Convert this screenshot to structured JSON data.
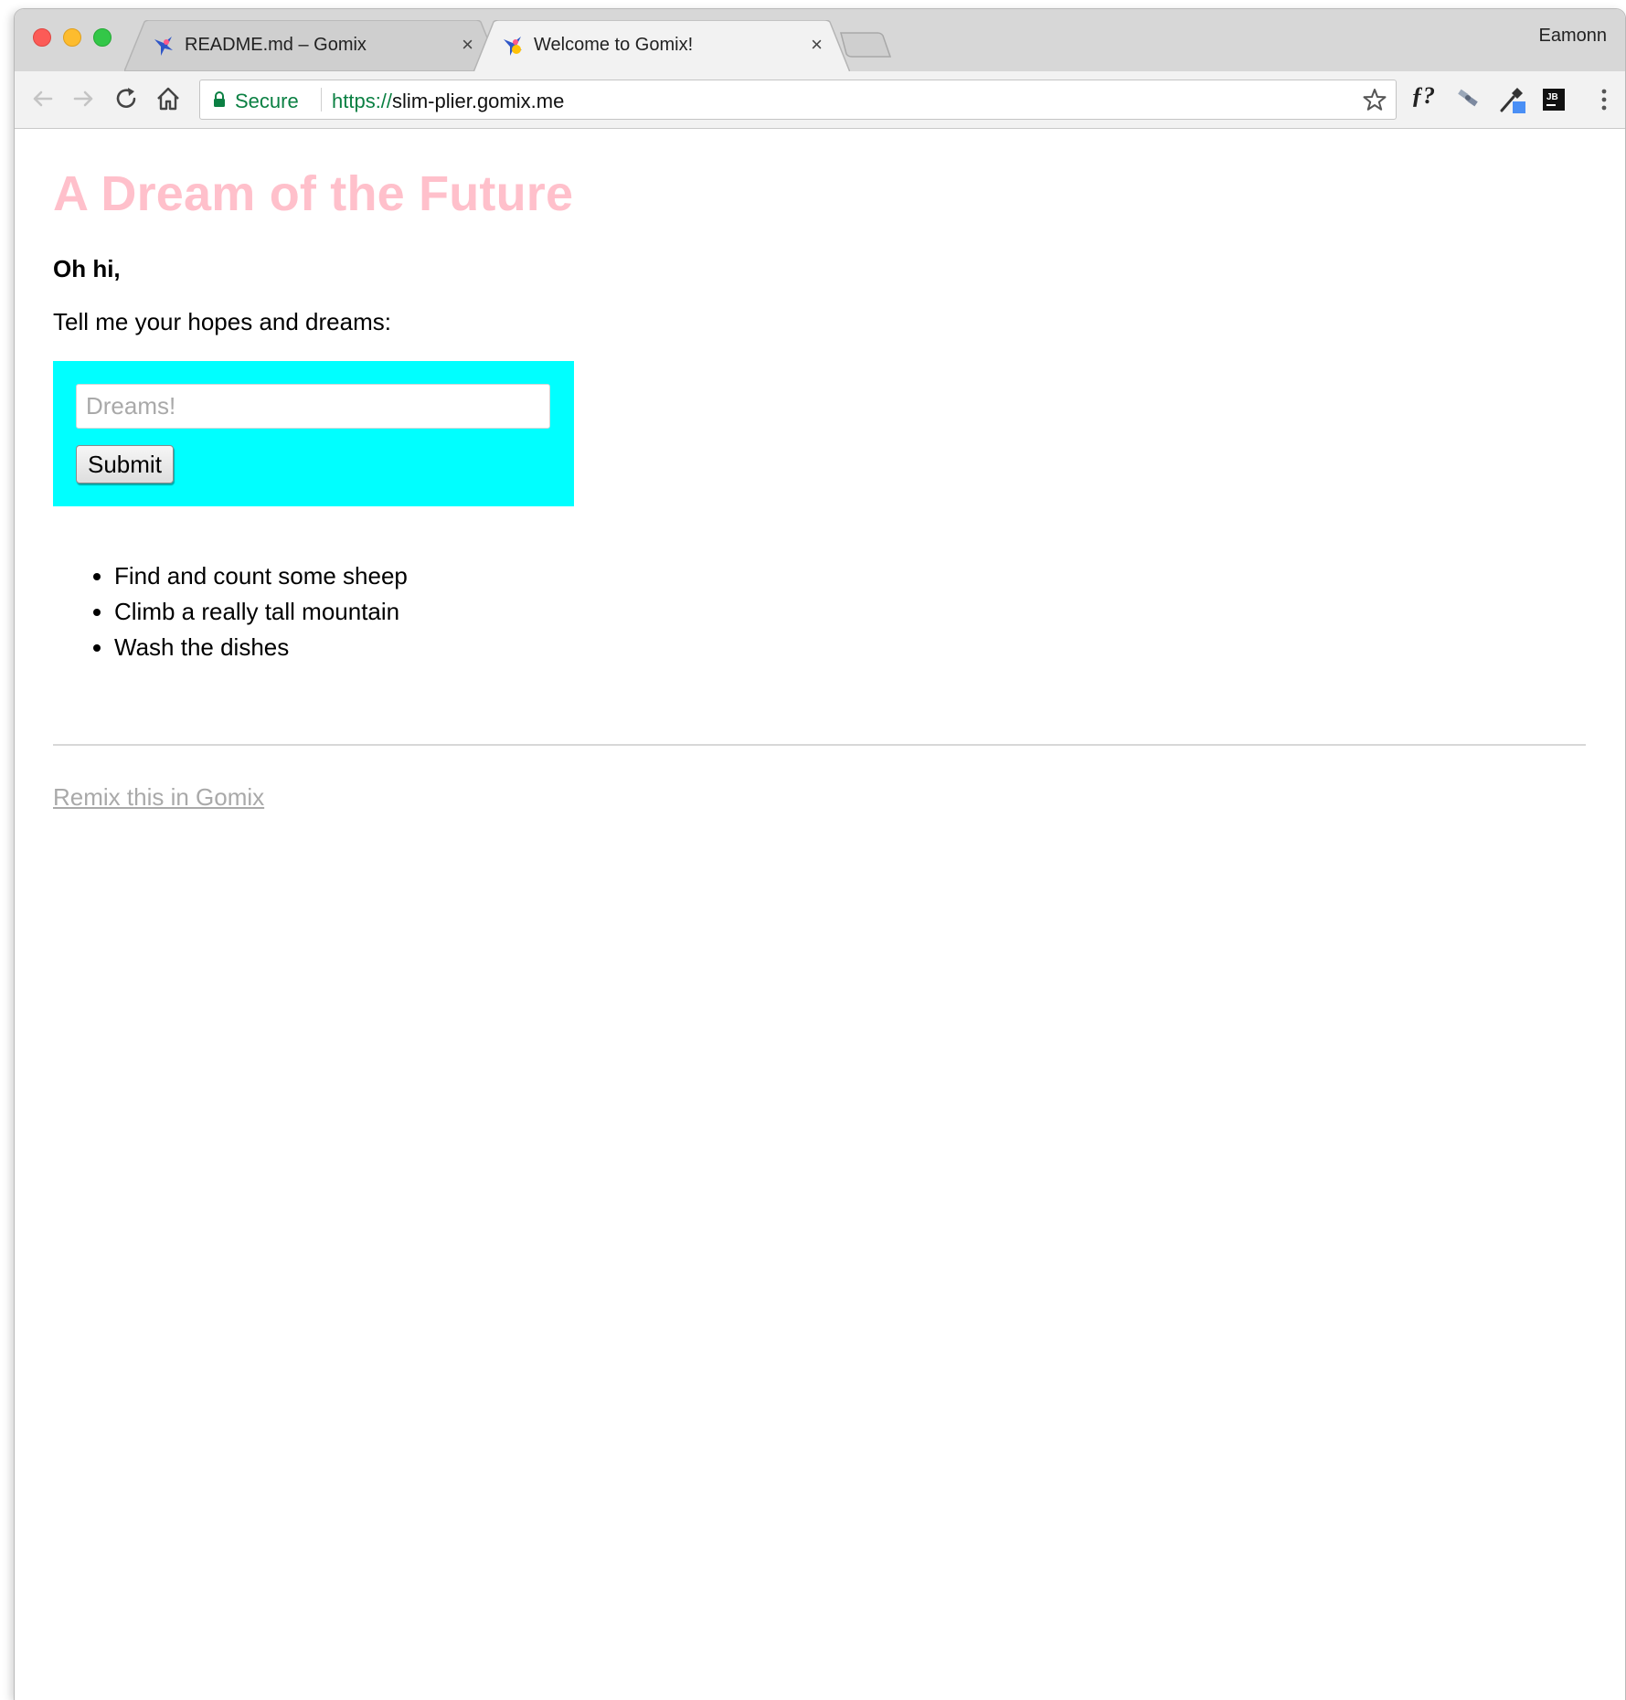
{
  "browser": {
    "profile_name": "Eamonn",
    "tabs": [
      {
        "title": "README.md – Gomix",
        "active": false,
        "close_glyph": "×"
      },
      {
        "title": "Welcome to Gomix!",
        "active": true,
        "close_glyph": "×"
      }
    ],
    "omnibox": {
      "secure_label": "Secure",
      "url_scheme": "https://",
      "url_host": "slim-plier.gomix.me"
    },
    "extensions": [
      {
        "label": "ƒ?",
        "icon": "function-ext-icon"
      },
      {
        "icon": "satellite-ext-icon"
      },
      {
        "icon": "eyedropper-ext-icon"
      },
      {
        "label": "JB",
        "icon": "jetbrains-ext-icon"
      }
    ],
    "icons": [
      "back-icon",
      "forward-icon",
      "reload-icon",
      "home-icon",
      "lock-icon",
      "star-icon",
      "menu-kebab-icon"
    ],
    "colors": {
      "secure_green": "#0b8043",
      "close_red": "#fc5b57",
      "minimize_yellow": "#fdbc2e",
      "maximize_green": "#33c748"
    }
  },
  "page": {
    "title": "A Dream of the Future",
    "greeting": "Oh hi,",
    "prompt": "Tell me your hopes and dreams:",
    "form": {
      "input_placeholder": "Dreams!",
      "input_value": "",
      "submit_label": "Submit"
    },
    "dreams": [
      "Find and count some sheep",
      "Climb a really tall mountain",
      "Wash the dishes"
    ],
    "remix_link": "Remix this in Gomix",
    "colors": {
      "title_pink": "#ffc0cb",
      "form_background": "#00ffff",
      "link_gray": "#a9a9a9"
    }
  }
}
